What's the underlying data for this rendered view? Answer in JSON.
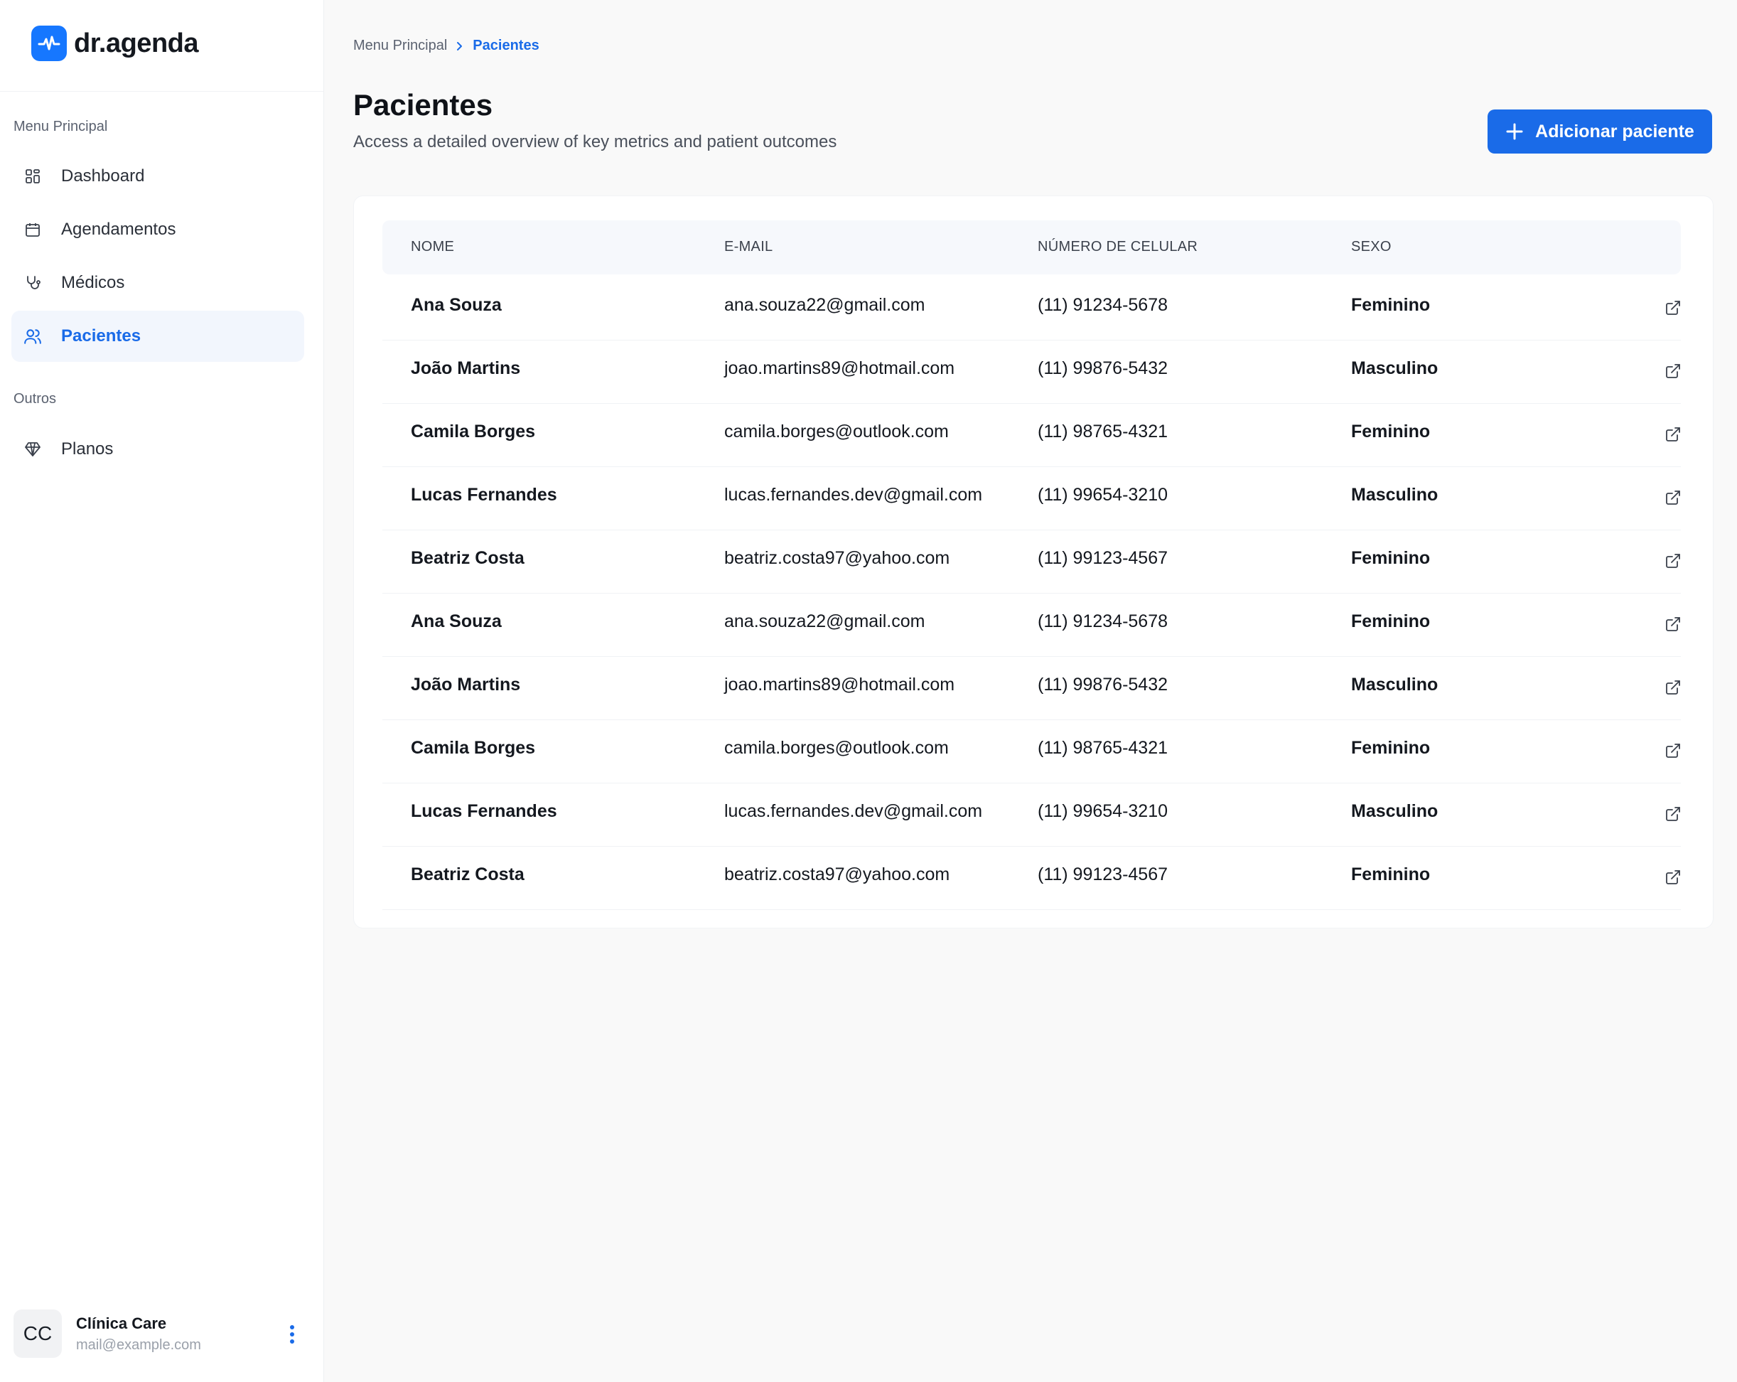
{
  "brand": {
    "name": "dr.agenda",
    "color": "#1677ff"
  },
  "sidebar": {
    "section_main": "Menu Principal",
    "section_other": "Outros",
    "items": [
      {
        "label": "Dashboard",
        "icon": "dashboard-icon"
      },
      {
        "label": "Agendamentos",
        "icon": "calendar-icon"
      },
      {
        "label": "Médicos",
        "icon": "stethoscope-icon"
      },
      {
        "label": "Pacientes",
        "icon": "users-icon",
        "active": true
      }
    ],
    "other_items": [
      {
        "label": "Planos",
        "icon": "diamond-icon"
      }
    ],
    "user": {
      "initials": "CC",
      "name": "Clínica Care",
      "email": "mail@example.com"
    }
  },
  "breadcrumb": {
    "parent": "Menu Principal",
    "current": "Pacientes"
  },
  "page": {
    "title": "Pacientes",
    "subtitle": "Access a detailed overview of key metrics and patient outcomes",
    "add_button_label": "Adicionar paciente"
  },
  "table": {
    "headers": {
      "name": "NOME",
      "email": "E-MAIL",
      "phone": "NÚMERO DE CELULAR",
      "sex": "SEXO"
    },
    "rows": [
      {
        "name": "Ana Souza",
        "email": "ana.souza22@gmail.com",
        "phone": "(11) 91234-5678",
        "sex": "Feminino"
      },
      {
        "name": "João Martins",
        "email": "joao.martins89@hotmail.com",
        "phone": "(11) 99876-5432",
        "sex": "Masculino"
      },
      {
        "name": "Camila Borges",
        "email": "camila.borges@outlook.com",
        "phone": "(11) 98765-4321",
        "sex": "Feminino"
      },
      {
        "name": "Lucas Fernandes",
        "email": "lucas.fernandes.dev@gmail.com",
        "phone": "(11) 99654-3210",
        "sex": "Masculino"
      },
      {
        "name": "Beatriz Costa",
        "email": "beatriz.costa97@yahoo.com",
        "phone": "(11) 99123-4567",
        "sex": "Feminino"
      },
      {
        "name": "Ana Souza",
        "email": "ana.souza22@gmail.com",
        "phone": "(11) 91234-5678",
        "sex": "Feminino"
      },
      {
        "name": "João Martins",
        "email": "joao.martins89@hotmail.com",
        "phone": "(11) 99876-5432",
        "sex": "Masculino"
      },
      {
        "name": "Camila Borges",
        "email": "camila.borges@outlook.com",
        "phone": "(11) 98765-4321",
        "sex": "Feminino"
      },
      {
        "name": "Lucas Fernandes",
        "email": "lucas.fernandes.dev@gmail.com",
        "phone": "(11) 99654-3210",
        "sex": "Masculino"
      },
      {
        "name": "Beatriz Costa",
        "email": "beatriz.costa97@yahoo.com",
        "phone": "(11) 99123-4567",
        "sex": "Feminino"
      }
    ]
  },
  "colors": {
    "accent": "#1a6be8",
    "active_bg": "#f2f6fd"
  }
}
